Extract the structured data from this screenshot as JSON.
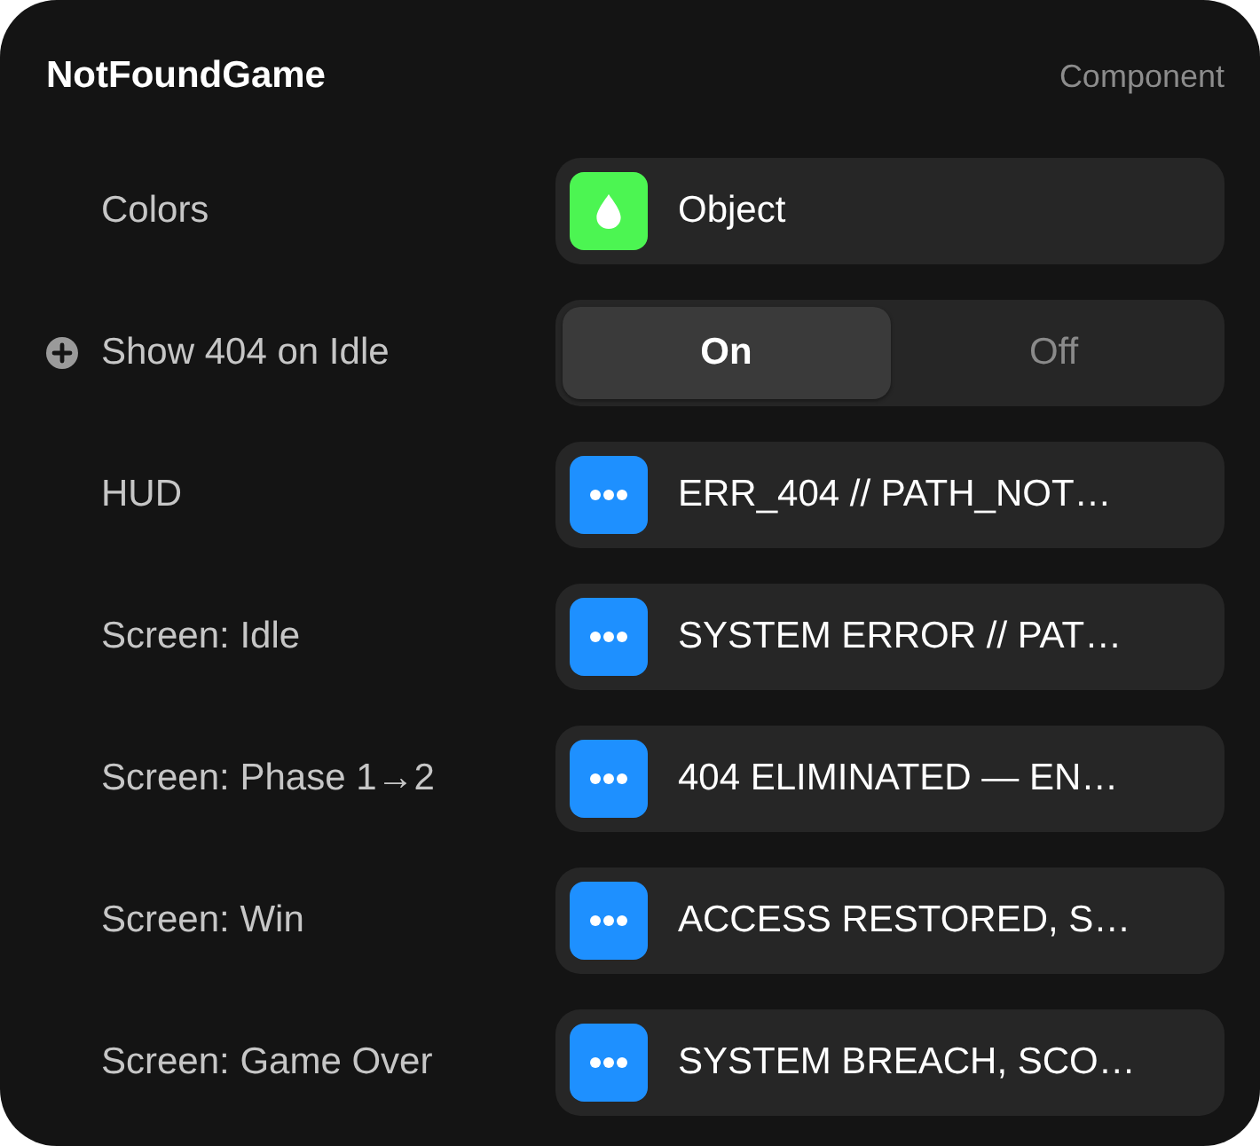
{
  "panel": {
    "title": "NotFoundGame",
    "type_label": "Component"
  },
  "properties": [
    {
      "kind": "color",
      "label": "Colors",
      "value": "Object"
    },
    {
      "kind": "toggle",
      "label": "Show 404 on Idle",
      "add_button": true,
      "options": [
        {
          "label": "On",
          "selected": true
        },
        {
          "label": "Off",
          "selected": false
        }
      ]
    },
    {
      "kind": "text",
      "label": "HUD",
      "value": "ERR_404 // PATH_NOT…"
    },
    {
      "kind": "text",
      "label": "Screen: Idle",
      "value": "SYSTEM ERROR // PAT…"
    },
    {
      "kind": "text",
      "label": "Screen: Phase 1→2",
      "value": "404 ELIMINATED — EN…"
    },
    {
      "kind": "text",
      "label": "Screen: Win",
      "value": "ACCESS RESTORED, S…"
    },
    {
      "kind": "text",
      "label": "Screen: Game Over",
      "value": "SYSTEM BREACH, SCO…"
    }
  ]
}
